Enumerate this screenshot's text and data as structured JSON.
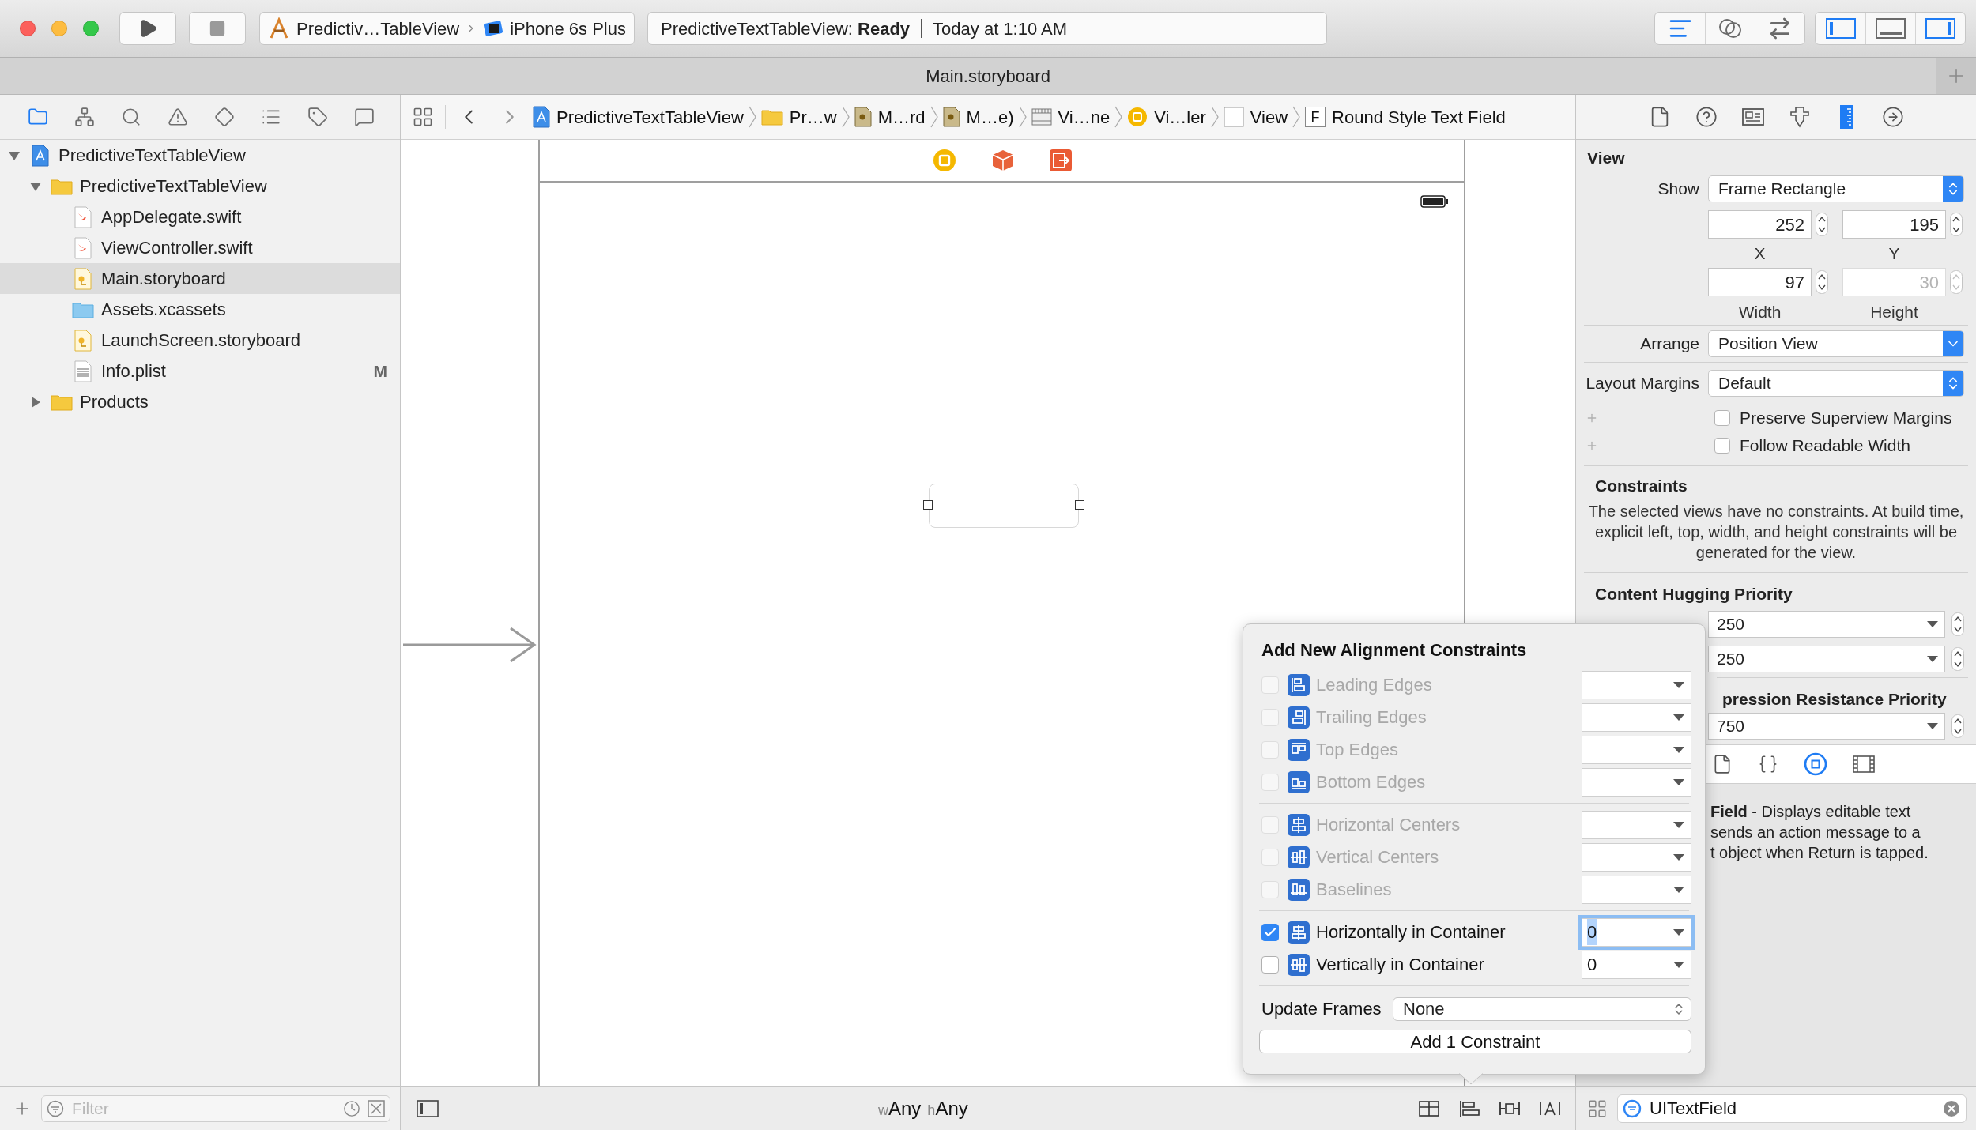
{
  "toolbar": {
    "scheme": "Predictiv…TableView",
    "device": "iPhone 6s Plus",
    "status": "PredictiveTextTableView: **Ready**",
    "time": "Today at 1:10 AM",
    "editor_modes": [
      {
        "kind": "standard",
        "selected": true
      },
      {
        "kind": "assistant",
        "selected": false
      },
      {
        "kind": "version",
        "selected": false
      }
    ],
    "view_toggles": [
      {
        "kind": "navigator",
        "on": true
      },
      {
        "kind": "debug",
        "on": false
      },
      {
        "kind": "utilities",
        "on": true
      }
    ]
  },
  "tab": {
    "title": "Main.storyboard"
  },
  "navigator_tabs": [
    {
      "kind": "project",
      "selected": true
    },
    {
      "kind": "symbols",
      "selected": false
    },
    {
      "kind": "find",
      "selected": false
    },
    {
      "kind": "issues",
      "selected": false
    },
    {
      "kind": "tests",
      "selected": false
    },
    {
      "kind": "debug",
      "selected": false
    },
    {
      "kind": "breakpoints",
      "selected": false
    },
    {
      "kind": "reports",
      "selected": false
    }
  ],
  "project_tree": [
    {
      "name": "PredictiveTextTableView",
      "kind": "project",
      "expanded": true,
      "selected": false,
      "children": [
        {
          "name": "PredictiveTextTableView",
          "kind": "folder",
          "expanded": true,
          "selected": false,
          "children": [
            {
              "name": "AppDelegate.swift",
              "kind": "swift",
              "selected": false
            },
            {
              "name": "ViewController.swift",
              "kind": "swift",
              "selected": false
            },
            {
              "name": "Main.storyboard",
              "kind": "storyboard",
              "selected": true
            },
            {
              "name": "Assets.xcassets",
              "kind": "assets",
              "selected": false
            },
            {
              "name": "LaunchScreen.storyboard",
              "kind": "storyboard",
              "selected": false
            },
            {
              "name": "Info.plist",
              "kind": "plist",
              "selected": false,
              "badge": "M"
            }
          ]
        },
        {
          "name": "Products",
          "kind": "folder",
          "expanded": false,
          "selected": false
        }
      ]
    }
  ],
  "navigator_filter": {
    "placeholder": "Filter"
  },
  "jump_bar": [
    {
      "label": "PredictiveTextTableView",
      "kind": "project"
    },
    {
      "label": "Pr…w",
      "kind": "folder"
    },
    {
      "label": "M…rd",
      "kind": "storyboard"
    },
    {
      "label": "M…e)",
      "kind": "storyboard"
    },
    {
      "label": "Vi…ne",
      "kind": "scene"
    },
    {
      "label": "Vi…ler",
      "kind": "controller"
    },
    {
      "label": "View",
      "kind": "view"
    },
    {
      "label": "Round Style Text Field",
      "kind": "textfield",
      "badge": "F"
    }
  ],
  "canvas": {
    "size_class": [
      {
        "prefix": "w",
        "value": "Any"
      },
      {
        "prefix": "h",
        "value": "Any"
      }
    ]
  },
  "inspector_tabs": [
    {
      "kind": "file",
      "selected": false
    },
    {
      "kind": "help",
      "selected": false
    },
    {
      "kind": "identity",
      "selected": false
    },
    {
      "kind": "attributes",
      "selected": false
    },
    {
      "kind": "size",
      "selected": true
    },
    {
      "kind": "connections",
      "selected": false
    }
  ],
  "inspector": {
    "title": "View",
    "show": {
      "label": "Show",
      "value": "Frame Rectangle"
    },
    "frame_fields": [
      {
        "label": "X",
        "value": "252",
        "disabled": false
      },
      {
        "label": "Y",
        "value": "195",
        "disabled": false
      },
      {
        "label": "Width",
        "value": "97",
        "disabled": false
      },
      {
        "label": "Height",
        "value": "30",
        "disabled": true
      }
    ],
    "arrange": {
      "label": "Arrange",
      "value": "Position View"
    },
    "layout_margins": {
      "label": "Layout Margins",
      "value": "Default"
    },
    "options": [
      {
        "label": "Preserve Superview Margins",
        "checked": false
      },
      {
        "label": "Follow Readable Width",
        "checked": false
      }
    ],
    "constraints": {
      "title": "Constraints",
      "text": "The selected views have no constraints. At build time, explicit left, top, width, and height constraints will be generated for the view."
    },
    "hugging": {
      "title": "Content Hugging Priority",
      "values": [
        "250",
        "250"
      ]
    },
    "compression": {
      "title": "pression Resistance Priority",
      "values": [
        "750"
      ]
    },
    "library_tabs": [
      {
        "kind": "file",
        "selected": false
      },
      {
        "kind": "code",
        "selected": false
      },
      {
        "kind": "object",
        "selected": true
      },
      {
        "kind": "media",
        "selected": false
      }
    ],
    "description": [
      "**Field** - Displays editable text",
      "sends an action message to a",
      "t object when Return is tapped."
    ],
    "filter": {
      "value": "UITextField"
    }
  },
  "popover": {
    "title": "Add New Alignment Constraints",
    "groups": [
      [
        {
          "label": "Leading Edges",
          "kind": "leading",
          "checked": false,
          "disabled": true,
          "focused": false
        },
        {
          "label": "Trailing Edges",
          "kind": "trailing",
          "checked": false,
          "disabled": true,
          "focused": false
        },
        {
          "label": "Top Edges",
          "kind": "top",
          "checked": false,
          "disabled": true,
          "focused": false
        },
        {
          "label": "Bottom Edges",
          "kind": "bottom",
          "checked": false,
          "disabled": true,
          "focused": false
        }
      ],
      [
        {
          "label": "Horizontal Centers",
          "kind": "hcenter",
          "checked": false,
          "disabled": true,
          "focused": false
        },
        {
          "label": "Vertical Centers",
          "kind": "vcenter",
          "checked": false,
          "disabled": true,
          "focused": false
        },
        {
          "label": "Baselines",
          "kind": "baseline",
          "checked": false,
          "disabled": true,
          "focused": false
        }
      ],
      [
        {
          "label": "Horizontally in Container",
          "kind": "hcenter",
          "checked": true,
          "disabled": false,
          "focused": true,
          "value": "0"
        },
        {
          "label": "Vertically in Container",
          "kind": "vcenter",
          "checked": false,
          "disabled": false,
          "focused": false,
          "value": "0"
        }
      ]
    ],
    "update_frames": {
      "label": "Update Frames",
      "value": "None"
    },
    "button": "Add 1 Constraint"
  }
}
